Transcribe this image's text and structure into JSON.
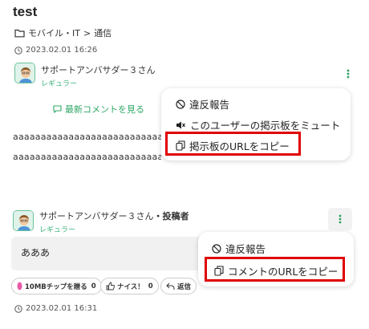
{
  "post": {
    "title": "test",
    "breadcrumb": {
      "category": "モバイル・IT",
      "separator": ">",
      "subcategory": "通信"
    },
    "date": "2023.02.01 16:26",
    "author": {
      "name": "サポートアンバサダー３さん",
      "rank": "レギュラー"
    },
    "latest_comment_link": "最新コメントを見る",
    "body_line_1": "aaaaaaaaaaaaaaaaaaaaaaaaaaaaaaaaa",
    "body_line_2": "aaaaaaaaaaaaaaaaaaaaaaaaaaaaaa"
  },
  "post_menu": {
    "items": [
      {
        "label": "違反報告",
        "icon": "prohibited-icon"
      },
      {
        "label": "このユーザーの掲示板をミュート",
        "icon": "mute-icon"
      },
      {
        "label": "掲示板のURLをコピー",
        "icon": "copy-icon"
      }
    ]
  },
  "comment": {
    "author": {
      "name": "サポートアンバサダー３さん",
      "tag": "・投稿者",
      "rank": "レギュラー"
    },
    "text": "あああ",
    "actions": {
      "chip_label": "10MBチップを贈る",
      "chip_count": "0",
      "nice_label": "ナイス！",
      "nice_count": "0",
      "reply_label": "返信"
    },
    "date": "2023.02.01 16:31"
  },
  "comment_menu": {
    "items": [
      {
        "label": "違反報告",
        "icon": "prohibited-icon"
      },
      {
        "label": "コメントのURLをコピー",
        "icon": "copy-icon"
      }
    ]
  },
  "colors": {
    "accent_green": "#3db37a",
    "highlight_red": "#e00000",
    "chip_pink": "#e85aa8"
  }
}
